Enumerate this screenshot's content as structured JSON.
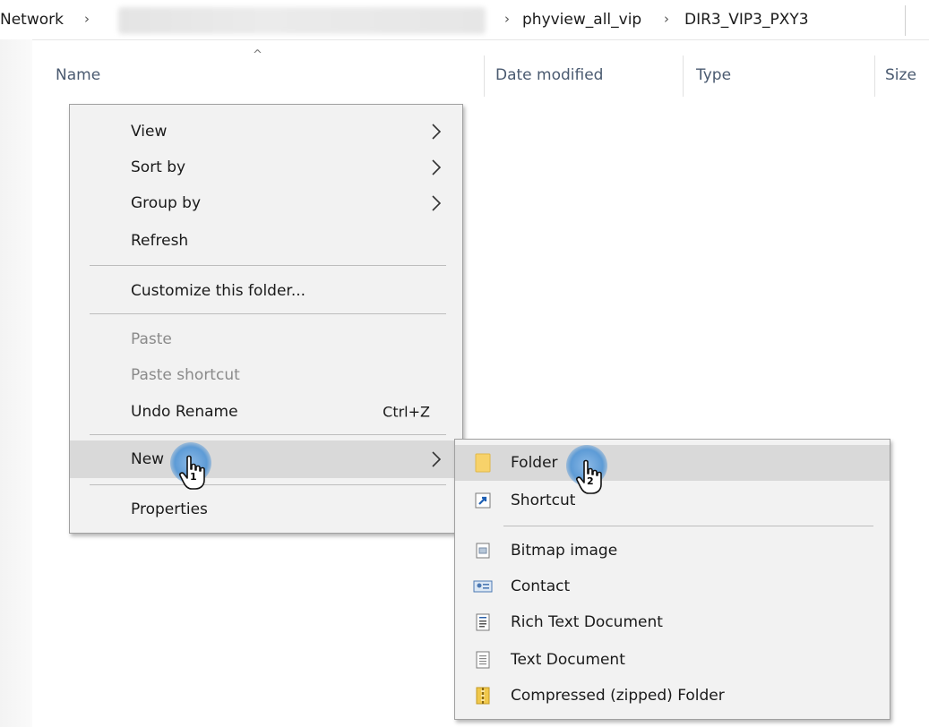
{
  "address_bar": {
    "root": "Network",
    "path": [
      "phyview_all_vip",
      "DIR3_VIP3_PXY3"
    ],
    "separator": "›"
  },
  "columns": [
    "Name",
    "Date modified",
    "Type",
    "Size"
  ],
  "context_menu": {
    "items": [
      {
        "label": "View",
        "submenu": true
      },
      {
        "label": "Sort by",
        "submenu": true
      },
      {
        "label": "Group by",
        "submenu": true
      },
      {
        "label": "Refresh"
      },
      {
        "label": "Customize this folder..."
      },
      {
        "label": "Paste",
        "disabled": true
      },
      {
        "label": "Paste shortcut",
        "disabled": true
      },
      {
        "label": "Undo Rename",
        "shortcut": "Ctrl+Z"
      },
      {
        "label": "New",
        "submenu": true,
        "highlighted": true
      },
      {
        "label": "Properties"
      }
    ]
  },
  "new_submenu": {
    "items": [
      {
        "label": "Folder",
        "icon": "folder-icon",
        "highlighted": true
      },
      {
        "label": "Shortcut",
        "icon": "shortcut-icon"
      },
      {
        "label": "Bitmap image",
        "icon": "bitmap-icon"
      },
      {
        "label": "Contact",
        "icon": "contact-icon"
      },
      {
        "label": "Rich Text Document",
        "icon": "rich-text-icon"
      },
      {
        "label": "Text Document",
        "icon": "text-document-icon"
      },
      {
        "label": "Compressed (zipped) Folder",
        "icon": "zip-folder-icon"
      }
    ]
  },
  "click_markers": [
    "1",
    "2"
  ],
  "colors": {
    "menu_bg": "#f2f2f2",
    "highlight": "#d9d9d9",
    "header_text": "#4a5a70",
    "click_marker": "#5d9bd6"
  }
}
